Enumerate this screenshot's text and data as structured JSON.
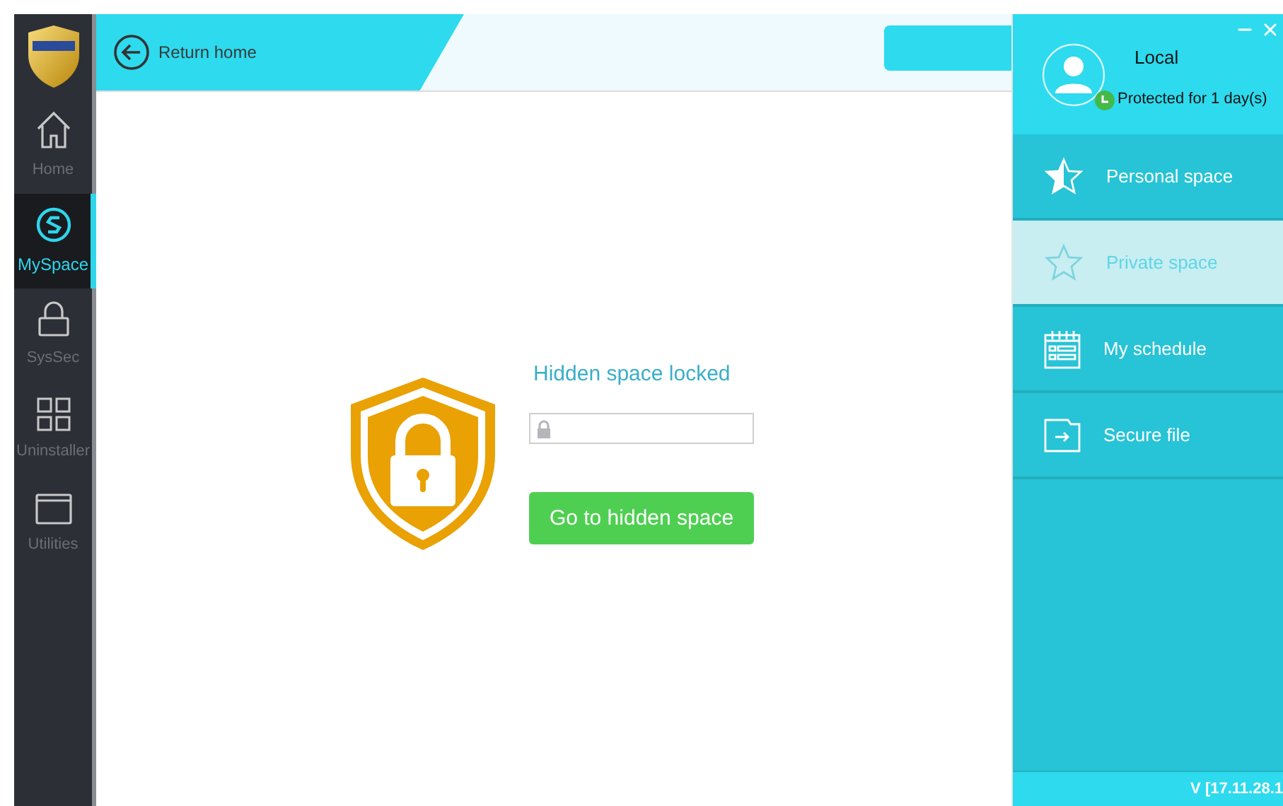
{
  "sidebar": {
    "items": [
      {
        "label": "Home",
        "selected": false
      },
      {
        "label": "MySpace",
        "selected": true
      },
      {
        "label": "SysSec",
        "selected": false
      },
      {
        "label": "Uninstaller",
        "selected": false
      },
      {
        "label": "Utilities",
        "selected": false
      }
    ]
  },
  "top_bar": {
    "back_label": "Return home"
  },
  "lock_panel": {
    "title": "Hidden space locked",
    "button": "Go to hidden space"
  },
  "account": {
    "name": "Local",
    "status": "Protected for 1 day(s)"
  },
  "menu": [
    {
      "label": "Personal space",
      "selected": false
    },
    {
      "label": "Private space",
      "selected": true
    },
    {
      "label": "My schedule",
      "selected": false
    },
    {
      "label": "Secure file",
      "selected": false
    }
  ],
  "version": "V [17.11.28.1"
}
